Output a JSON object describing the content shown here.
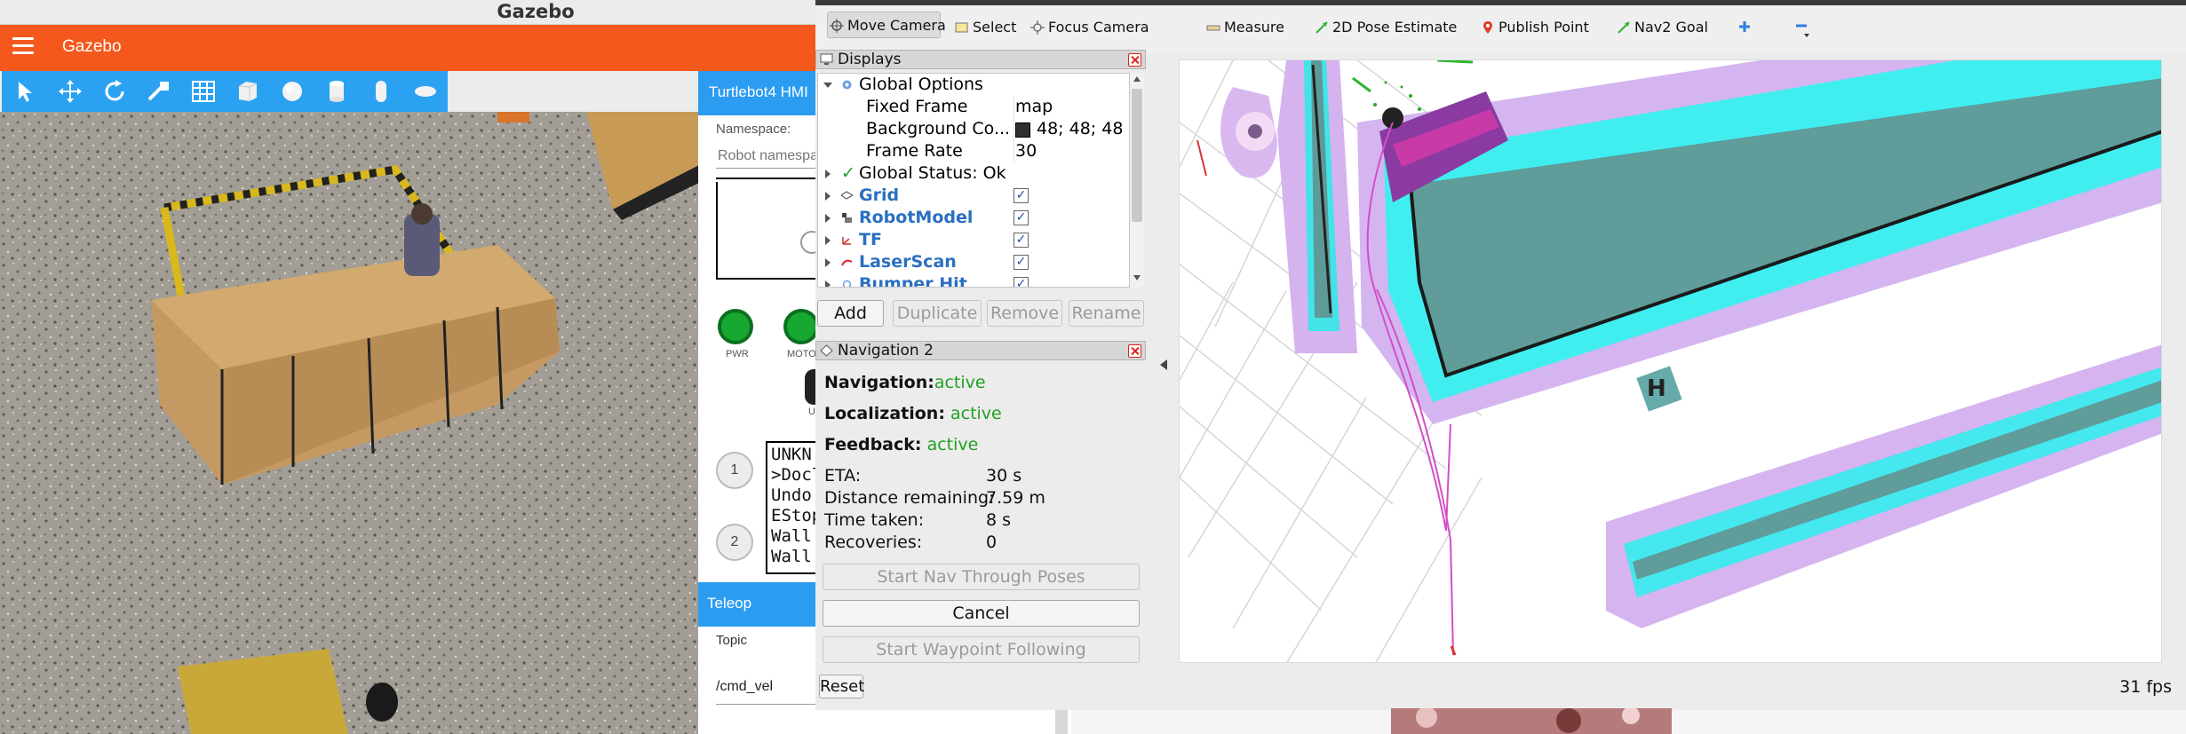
{
  "gazebo": {
    "window_title": "Gazebo",
    "app_label": "Gazebo",
    "tools": [
      "select-tool",
      "translate-tool",
      "rotate-tool",
      "scale-tool",
      "grid-tool",
      "box-shape",
      "sphere-shape",
      "cylinder-shape",
      "capsule-shape",
      "ellipsoid-shape"
    ]
  },
  "hmi": {
    "title": "Turtlebot4 HMI",
    "namespace_label": "Namespace:",
    "namespace_placeholder": "Robot namespa",
    "leds": [
      "PWR",
      "MOTO"
    ],
    "num_buttons": [
      "1",
      "2"
    ],
    "menu_lines": [
      "UNKN",
      ">Docl",
      "Undo",
      "EStop",
      "Wall",
      "Wall"
    ],
    "partial_label": "U",
    "teleop_title": "Teleop",
    "topic_label": "Topic",
    "topic_value": "/cmd_vel"
  },
  "rviz": {
    "toolbar": [
      {
        "label": "Move Camera",
        "icon": "move-camera-icon"
      },
      {
        "label": "Select",
        "icon": "select-icon"
      },
      {
        "label": "Focus Camera",
        "icon": "focus-camera-icon"
      },
      {
        "label": "Measure",
        "icon": "measure-icon"
      },
      {
        "label": "2D Pose Estimate",
        "icon": "pose-estimate-icon"
      },
      {
        "label": "Publish Point",
        "icon": "publish-point-icon"
      },
      {
        "label": "Nav2 Goal",
        "icon": "nav2-goal-icon"
      }
    ],
    "displays": {
      "title": "Displays",
      "global_options": "Global Options",
      "props": [
        {
          "name": "Fixed Frame",
          "value": "map"
        },
        {
          "name": "Background Co...",
          "value": "48; 48; 48"
        },
        {
          "name": "Frame Rate",
          "value": "30"
        }
      ],
      "global_status": "Global Status: Ok",
      "plugins": [
        "Grid",
        "RobotModel",
        "TF",
        "LaserScan",
        "Bumper Hit"
      ],
      "buttons": [
        "Add",
        "Duplicate",
        "Remove",
        "Rename"
      ],
      "background_color": "#303030"
    },
    "nav2": {
      "title": "Navigation 2",
      "status": [
        {
          "label": "Navigation:",
          "value": "active"
        },
        {
          "label": "Localization:",
          "value": "active"
        },
        {
          "label": "Feedback:",
          "value": "active"
        }
      ],
      "metrics": [
        {
          "label": "ETA:",
          "value": "30 s"
        },
        {
          "label": "Distance remaining:",
          "value": "7.59 m"
        },
        {
          "label": "Time taken:",
          "value": "8 s"
        },
        {
          "label": "Recoveries:",
          "value": "0"
        }
      ],
      "buttons": {
        "start_nav": "Start Nav Through Poses",
        "cancel": "Cancel",
        "start_waypoint": "Start Waypoint Following"
      }
    },
    "reset_label": "Reset",
    "fps": "31 fps"
  },
  "colors": {
    "gazebo_orange": "#f4581c",
    "hmi_blue": "#2b9cf0",
    "led_green": "#16a831",
    "nav_active_green": "#20a020",
    "costmap_purple": "#c8a0e0",
    "costmap_cyan": "#40f0f0"
  }
}
